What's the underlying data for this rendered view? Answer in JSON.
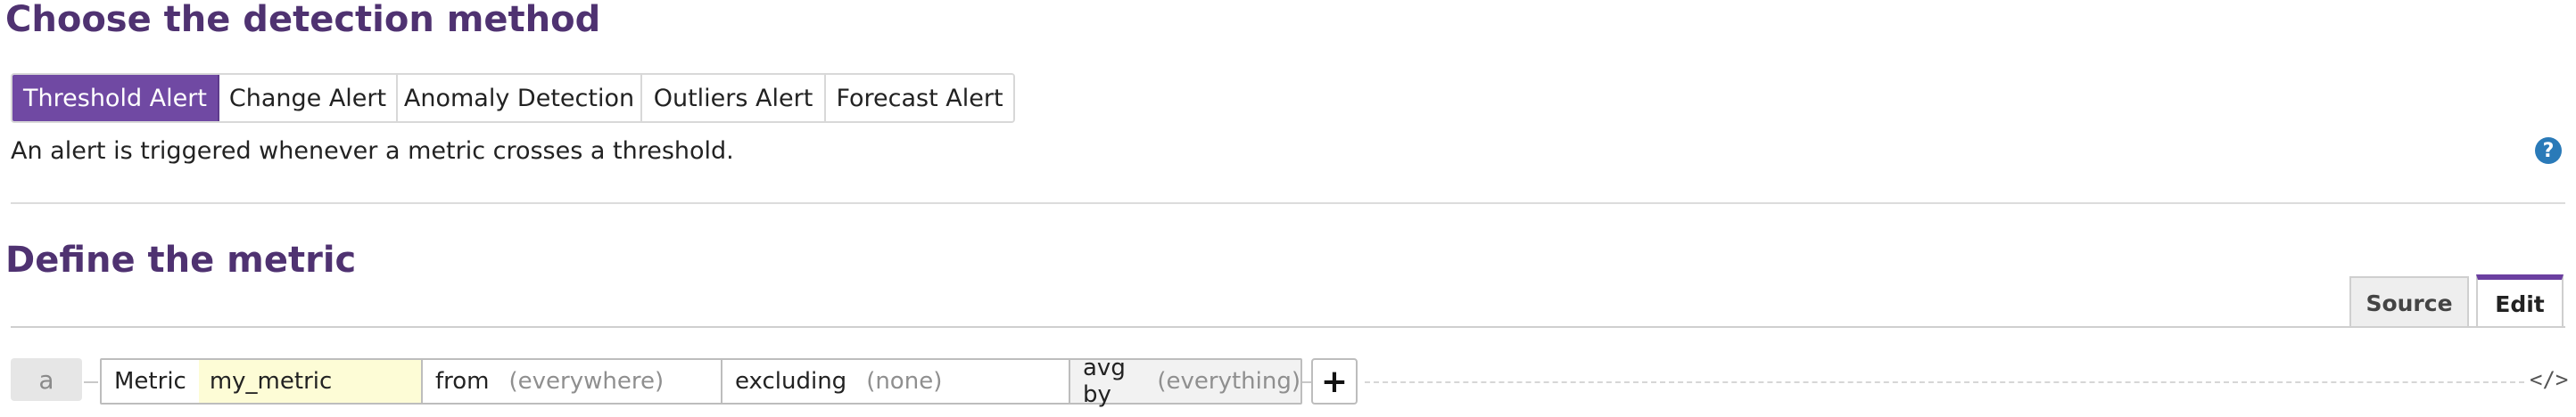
{
  "section1": {
    "title": "Choose the detection method",
    "tabs": [
      {
        "label": "Threshold Alert",
        "active": true
      },
      {
        "label": "Change Alert",
        "active": false
      },
      {
        "label": "Anomaly Detection",
        "active": false
      },
      {
        "label": "Outliers Alert",
        "active": false
      },
      {
        "label": "Forecast Alert",
        "active": false
      }
    ],
    "description": "An alert is triggered whenever a metric crosses a threshold.",
    "help_glyph": "?"
  },
  "section2": {
    "title": "Define the metric",
    "editor_tabs": {
      "source": "Source",
      "edit": "Edit",
      "active": "Edit"
    },
    "query": {
      "label": "a",
      "metric_label": "Metric",
      "metric_value": "my_metric",
      "from_label": "from",
      "from_value": "(everywhere)",
      "excluding_label": "excluding",
      "excluding_value": "(none)",
      "avg_label": "avg by",
      "avg_value": "(everything)",
      "add_glyph": "+",
      "code_glyph": "</>"
    }
  },
  "colors": {
    "accent": "#7049a3",
    "title": "#4f3271",
    "help": "#2a7ab8",
    "metric_highlight": "#fdfcd6"
  }
}
